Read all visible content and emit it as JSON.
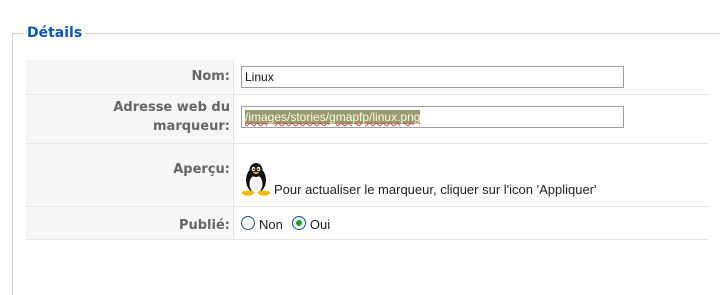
{
  "section": {
    "legend": "Détails"
  },
  "fields": {
    "name": {
      "label": "Nom:",
      "value": "Linux"
    },
    "marker_url": {
      "label_line1": "Adresse web du",
      "label_line2": "marqueur:",
      "value": "/images/stories/gmapfp/linux.png"
    },
    "preview": {
      "label": "Aperçu:",
      "text": "Pour actualiser le marqueur, cliquer sur l'icon 'Appliquer'",
      "icon": "tux-penguin-icon"
    },
    "published": {
      "label": "Publié:",
      "options": [
        {
          "label": "Non",
          "checked": false
        },
        {
          "label": "Oui",
          "checked": true
        }
      ]
    }
  }
}
